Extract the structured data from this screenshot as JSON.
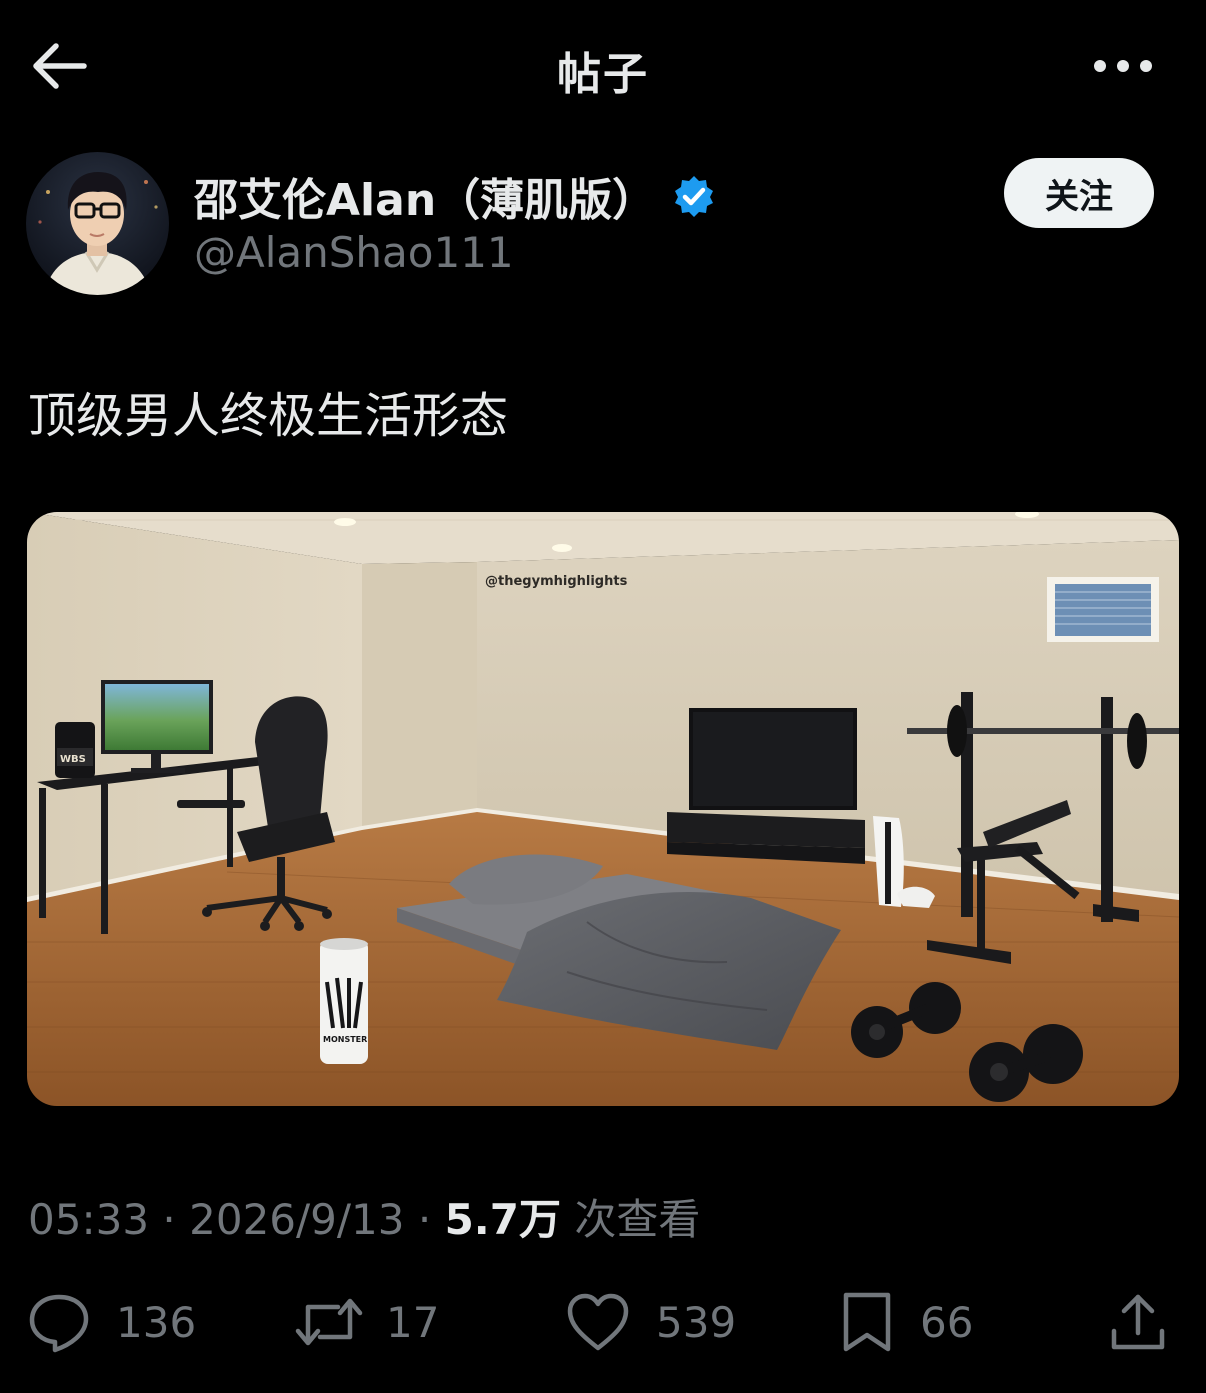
{
  "header": {
    "title": "帖子",
    "back_icon": "arrow-left-icon",
    "more_icon": "more-horizontal-icon"
  },
  "author": {
    "display_name": "邵艾伦Alan（薄肌版）",
    "handle": "@AlanShao111",
    "verified": true,
    "verified_color": "#1d9bf0",
    "follow_label": "关注"
  },
  "post": {
    "text": "顶级男人终极生活形态",
    "image": {
      "watermark": "@thegymhighlights",
      "tub_label": "WBS",
      "can_label": "MONSTER"
    }
  },
  "meta": {
    "time": "05:33",
    "separator": "·",
    "date": "2026/9/13",
    "views_count": "5.7万",
    "views_label": "次查看"
  },
  "actions": [
    {
      "name": "reply",
      "icon": "reply-icon",
      "count": "136"
    },
    {
      "name": "repost",
      "icon": "repost-icon",
      "count": "17"
    },
    {
      "name": "like",
      "icon": "heart-icon",
      "count": "539"
    },
    {
      "name": "bookmark",
      "icon": "bookmark-icon",
      "count": "66"
    },
    {
      "name": "share",
      "icon": "share-icon",
      "count": ""
    }
  ],
  "colors": {
    "background": "#000000",
    "text_primary": "#e7e9ea",
    "text_secondary": "#71767b",
    "follow_button_bg": "#eff3f4"
  }
}
